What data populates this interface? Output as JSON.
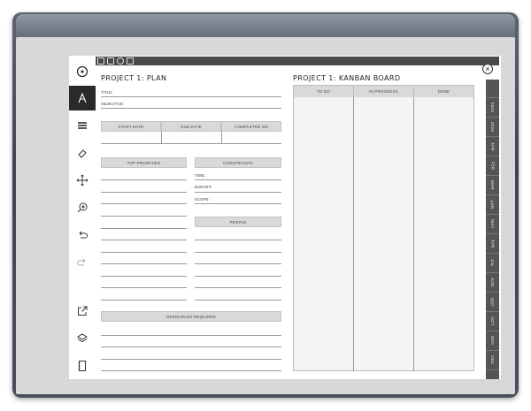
{
  "plan": {
    "title": "PROJECT 1: PLAN",
    "title_label": "TITLE:",
    "objective_label": "OBJECTIVE:",
    "dates": {
      "start": "START DATE",
      "due": "DUE DATE",
      "completed": "COMPLETED ON"
    },
    "priorities_header": "TOP PRIORITIES",
    "constraints": {
      "header": "CONSTRAINTS",
      "time": "TIME:",
      "budget": "BUDGET:",
      "scope": "SCOPE:"
    },
    "people_header": "PEOPLE",
    "resources_header": "RESOURCES REQUIRED"
  },
  "kanban": {
    "title": "PROJECT 1: KANBAN BOARD",
    "columns": [
      "TO DO",
      "IN PROGRESS",
      "DONE"
    ]
  },
  "tabs": [
    "2024",
    "2025",
    "JAN",
    "FEB",
    "MAR",
    "APR",
    "MAY",
    "JUN",
    "JUL",
    "AUG",
    "SEP",
    "OCT",
    "NOV",
    "DEC"
  ],
  "sidebar_tools": [
    "menu-circle-icon",
    "text-icon",
    "pen-lines-icon",
    "eraser-icon",
    "move-icon",
    "zoom-icon",
    "undo-icon",
    "redo-icon",
    "share-icon",
    "layers-icon",
    "pages-icon"
  ],
  "topbar_icons": [
    "home-icon",
    "mail-icon",
    "settings-icon",
    "document-icon"
  ],
  "close_symbol": "×"
}
